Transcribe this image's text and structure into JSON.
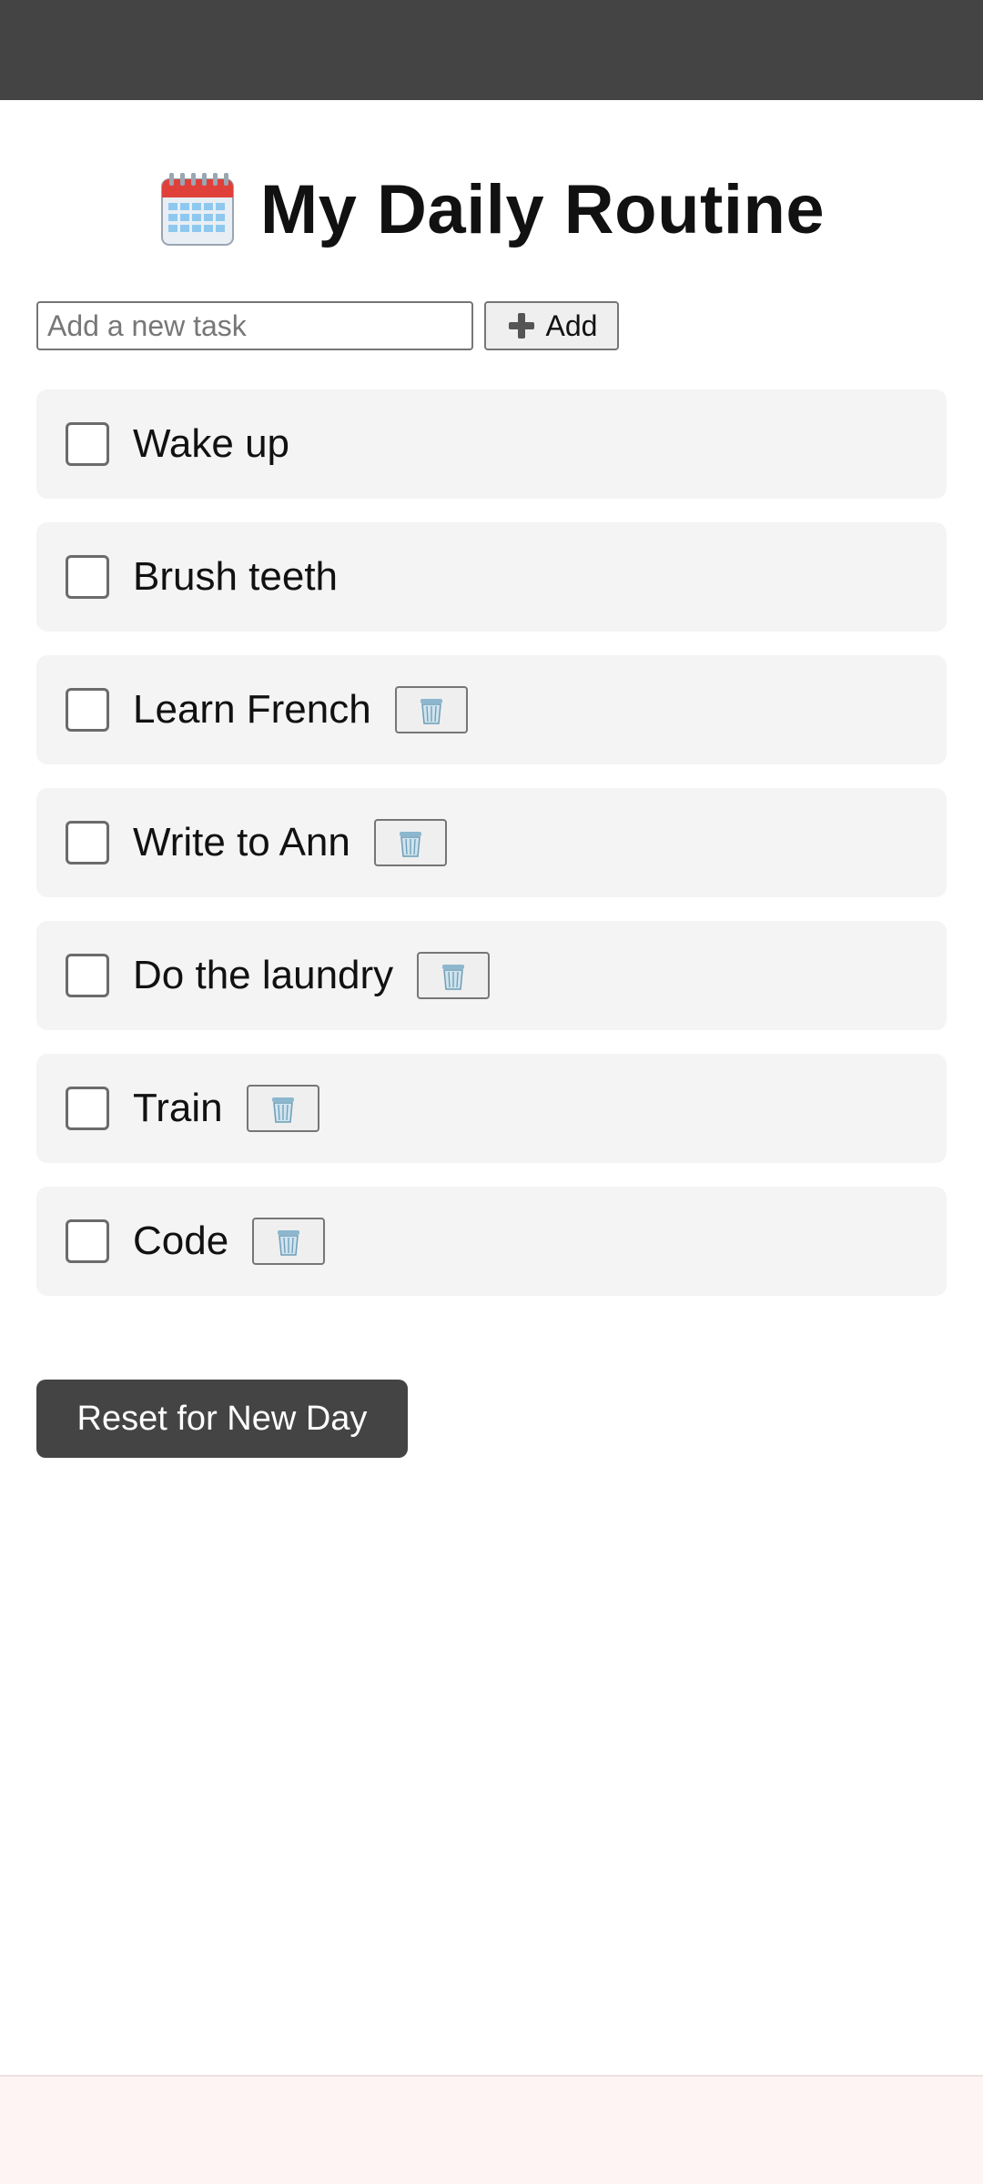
{
  "header": {
    "title_icon": "calendar-icon",
    "title": "My Daily Routine"
  },
  "add_task": {
    "placeholder": "Add a new task",
    "value": "",
    "button_icon": "plus-icon",
    "button_label": "Add"
  },
  "tasks": [
    {
      "label": "Wake up",
      "checked": false,
      "deletable": false
    },
    {
      "label": "Brush teeth",
      "checked": false,
      "deletable": false
    },
    {
      "label": "Learn French",
      "checked": false,
      "deletable": true
    },
    {
      "label": "Write to Ann",
      "checked": false,
      "deletable": true
    },
    {
      "label": "Do the laundry",
      "checked": false,
      "deletable": true
    },
    {
      "label": "Train",
      "checked": false,
      "deletable": true
    },
    {
      "label": "Code",
      "checked": false,
      "deletable": true
    }
  ],
  "reset_button": {
    "label": "Reset for New Day"
  },
  "colors": {
    "topbar": "#444444",
    "card_background": "#f4f4f4",
    "reset_button": "#444444",
    "bottom_strip": "#fdf4f3"
  }
}
